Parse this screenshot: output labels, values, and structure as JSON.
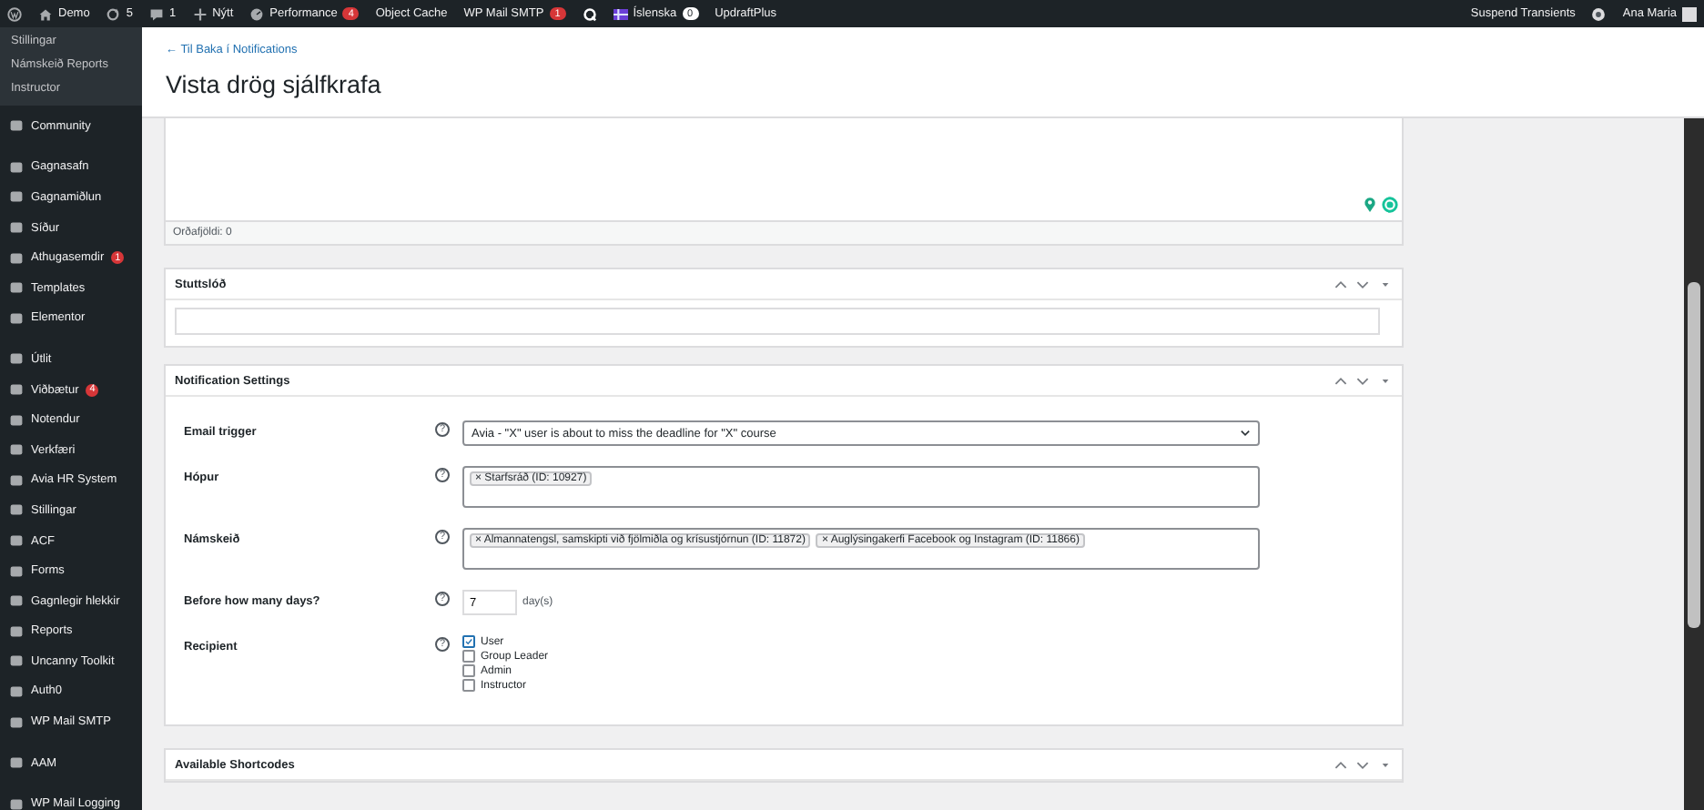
{
  "admin_bar": {
    "left": [
      {
        "kind": "logo"
      },
      {
        "kind": "home",
        "label": "Demo"
      },
      {
        "kind": "updates",
        "label": "5"
      },
      {
        "kind": "comments",
        "label": "1"
      },
      {
        "kind": "new",
        "label": "Nýtt"
      },
      {
        "kind": "performance",
        "label": "Performance",
        "badge": "4",
        "color": "#d63638"
      },
      {
        "kind": "text",
        "label": "Object Cache"
      },
      {
        "kind": "text",
        "label": "WP Mail SMTP",
        "badge": "1",
        "color": "#d63638"
      },
      {
        "kind": "q"
      },
      {
        "kind": "language",
        "label": "Íslenska",
        "badge": "0",
        "color": "#ffffff"
      },
      {
        "kind": "text",
        "label": "UpdraftPlus"
      }
    ],
    "right": [
      {
        "kind": "text",
        "label": "Suspend Transients"
      },
      {
        "kind": "status"
      },
      {
        "kind": "account",
        "label": "Ana Maria"
      }
    ]
  },
  "sidebar": {
    "submenu": [
      "Stillingar",
      "Námskeið Reports",
      "Instructor"
    ],
    "groups": [
      [
        {
          "label": "Community"
        }
      ],
      [
        {
          "label": "Gagnasafn"
        },
        {
          "label": "Gagnamiðlun"
        },
        {
          "label": "Síður"
        },
        {
          "label": "Athugasemdir",
          "badge": "1"
        },
        {
          "label": "Templates"
        },
        {
          "label": "Elementor"
        }
      ],
      [
        {
          "label": "Útlit"
        },
        {
          "label": "Viðbætur",
          "badge": "4"
        },
        {
          "label": "Notendur"
        },
        {
          "label": "Verkfæri"
        },
        {
          "label": "Avia HR System"
        },
        {
          "label": "Stillingar"
        },
        {
          "label": "ACF"
        },
        {
          "label": "Forms"
        },
        {
          "label": "Gagnlegir hlekkir"
        },
        {
          "label": "Reports"
        },
        {
          "label": "Uncanny Toolkit"
        },
        {
          "label": "Auth0"
        },
        {
          "label": "WP Mail SMTP"
        }
      ],
      [
        {
          "label": "AAM"
        }
      ],
      [
        {
          "label": "WP Mail Logging"
        }
      ]
    ]
  },
  "page": {
    "back_link": "← Til Baka í Notifications",
    "title": "Vista drög sjálfkrafa"
  },
  "editor": {
    "word_count": "Orðafjöldi: 0"
  },
  "slug_box": {
    "title": "Stuttslóð"
  },
  "notification_settings": {
    "title": "Notification Settings",
    "fields": [
      {
        "kind": "select",
        "label": "Email trigger",
        "help": "?",
        "value": "Avia - \"X\" user is about to miss the deadline for \"X\" course"
      },
      {
        "kind": "tags",
        "label": "Hópur",
        "help": "?",
        "tags": [
          "× Starfsráð (ID: 10927)"
        ]
      },
      {
        "kind": "tags",
        "label": "Námskeið",
        "help": "?",
        "tags": [
          "× Almannatengsl, samskipti við fjölmiðla og krísustjórnun (ID: 11872)",
          "× Auglýsingakerfi Facebook og Instagram (ID: 11866)"
        ]
      },
      {
        "kind": "number",
        "label": "Before how many days?",
        "help": "?",
        "value": "7",
        "unit": "day(s)"
      },
      {
        "kind": "checkboxes",
        "label": "Recipient",
        "help": "?",
        "options": [
          {
            "label": "User",
            "checked": true
          },
          {
            "label": "Group Leader",
            "checked": false
          },
          {
            "label": "Admin",
            "checked": false
          },
          {
            "label": "Instructor",
            "checked": false
          }
        ]
      }
    ]
  },
  "shortcodes_box": {
    "title": "Available Shortcodes"
  }
}
